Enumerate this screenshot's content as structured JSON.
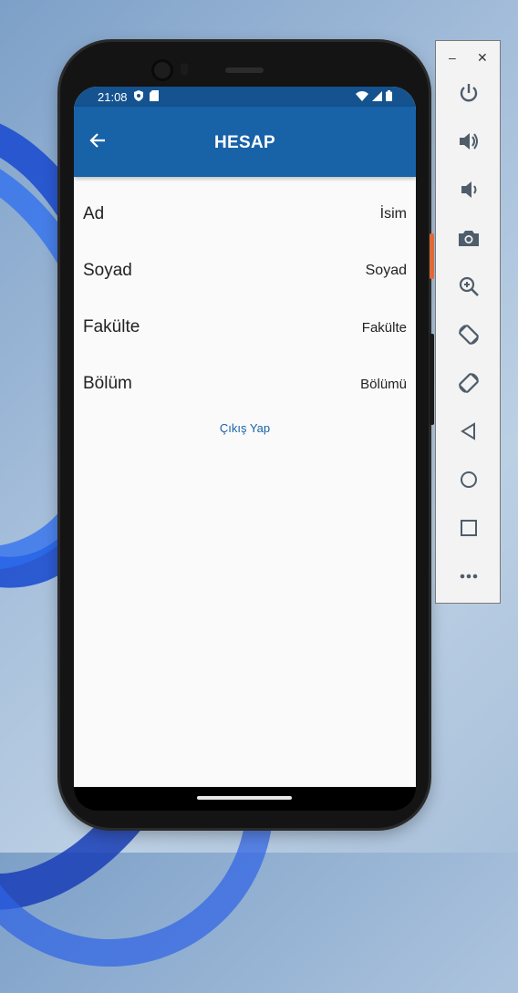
{
  "status_bar": {
    "time": "21:08"
  },
  "app_bar": {
    "title": "HESAP"
  },
  "account_fields": [
    {
      "label": "Ad",
      "value": "İsim"
    },
    {
      "label": "Soyad",
      "value": "Soyad"
    },
    {
      "label": "Fakülte",
      "value": "Fakülte"
    },
    {
      "label": "Bölüm",
      "value": "Bölümü"
    }
  ],
  "logout_label": "Çıkış Yap",
  "colors": {
    "app_bar": "#1862a8",
    "status_bar": "#14538f",
    "link": "#1862a8"
  },
  "emulator_panel": {
    "window_controls": [
      "minimize-icon",
      "close-icon"
    ],
    "buttons": [
      "power-icon",
      "volume-up-icon",
      "volume-down-icon",
      "camera-icon",
      "zoom-icon",
      "rotate-left-icon",
      "rotate-right-icon",
      "back-icon",
      "home-icon",
      "overview-icon",
      "more-icon"
    ]
  }
}
